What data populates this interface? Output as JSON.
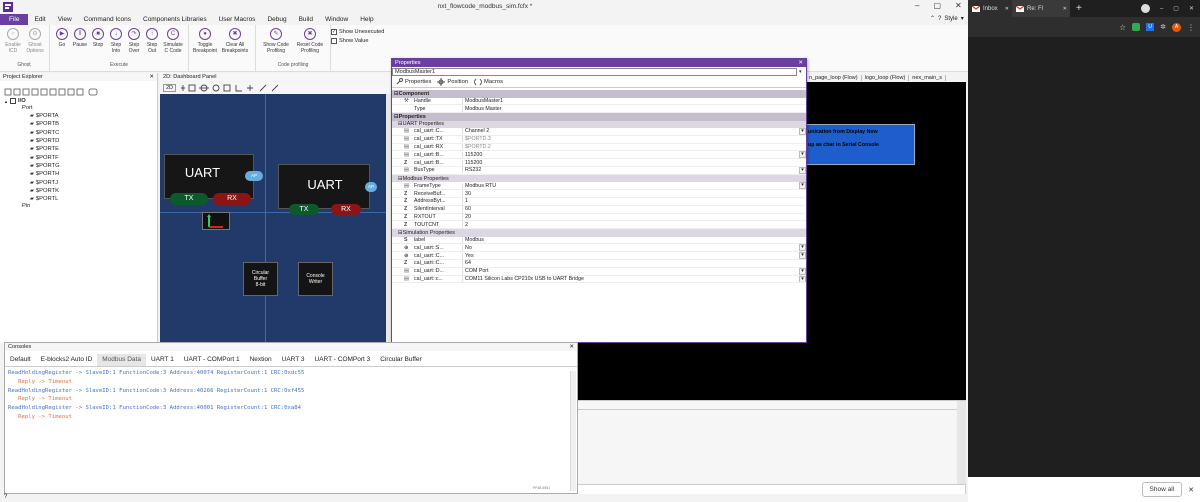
{
  "app": {
    "title": "nxt_flowcode_modbus_sim.fcfx *",
    "style_label": "Style",
    "window_icon": "flowcode-logo-icon"
  },
  "menu": [
    "File",
    "Edit",
    "View",
    "Command Icons",
    "Components Libraries",
    "User Macros",
    "Debug",
    "Build",
    "Window",
    "Help"
  ],
  "ribbon": {
    "groups": [
      {
        "label": "Ghost",
        "buttons": [
          "Enable\nICD",
          "Ghost\nOptions"
        ]
      },
      {
        "label": "Execute",
        "buttons": [
          "Go",
          "Pause",
          "Stop",
          "Step\nInto",
          "Step\nOver",
          "Step\nOut",
          "Simulate\nC Code"
        ]
      },
      {
        "label": "",
        "buttons": [
          "Toggle\nBreakpoint",
          "Clear All\nBreakpoints"
        ]
      },
      {
        "label": "Code profiling",
        "buttons": [
          "Show Code\nProfiling",
          "Reset Code\nProfiling"
        ]
      }
    ],
    "checks": [
      {
        "label": "Show Unexecuted",
        "checked": true
      },
      {
        "label": "Show Value",
        "checked": false
      }
    ]
  },
  "project_explorer": {
    "title": "Project Explorer",
    "root": "I/O",
    "port_label": "Port",
    "ports": [
      "$PORTA",
      "$PORTB",
      "$PORTC",
      "$PORTD",
      "$PORTE",
      "$PORTF",
      "$PORTG",
      "$PORTH",
      "$PORTJ",
      "$PORTK",
      "$PORTL"
    ],
    "pin_label": "Pin"
  },
  "dashboard": {
    "title": "2D: Dashboard Panel",
    "toolbar_label": "2D",
    "uart1": {
      "title": "UART",
      "tx": "TX",
      "rx": "RX",
      "badge": "AP"
    },
    "uart2": {
      "title": "UART",
      "tx": "TX",
      "rx": "RX",
      "badge": "AP"
    },
    "circular_buffer": "Circular\nBuffer\n8-bit",
    "console_writer": "Console\nWriter"
  },
  "properties": {
    "title": "Properties",
    "selector": "ModbusMaster1",
    "tabs": [
      "Properties",
      "Position",
      "Macros"
    ],
    "sections": [
      {
        "type": "section",
        "label": "Component"
      },
      {
        "type": "row",
        "icon": "wrench",
        "key": "Handle",
        "value": "ModbusMaster1",
        "dd": false
      },
      {
        "type": "row",
        "icon": "",
        "key": "Type",
        "value": "Modbus Master",
        "dd": false
      },
      {
        "type": "section",
        "label": "Properties"
      },
      {
        "type": "subsection",
        "label": "UART Properties"
      },
      {
        "type": "row",
        "icon": "list",
        "key": "cal_uart::C...",
        "value": "Channel 2",
        "dd": true
      },
      {
        "type": "row",
        "icon": "list",
        "key": "cal_uart::TX",
        "value": "$PORTD.3",
        "dd": false,
        "muted": true
      },
      {
        "type": "row",
        "icon": "list",
        "key": "cal_uart::RX",
        "value": "$PORTD.2",
        "dd": false,
        "muted": true
      },
      {
        "type": "row",
        "icon": "list",
        "key": "cal_uart::B...",
        "value": "115200",
        "dd": true
      },
      {
        "type": "row",
        "icon": "Z",
        "key": "cal_uart::B...",
        "value": "115200",
        "dd": false
      },
      {
        "type": "row",
        "icon": "list",
        "key": "BusType",
        "value": "RS232",
        "dd": true
      },
      {
        "type": "subsection",
        "label": "Modbus Properties"
      },
      {
        "type": "row",
        "icon": "list",
        "key": "FrameType",
        "value": "Modbus RTU",
        "dd": true
      },
      {
        "type": "row",
        "icon": "Z",
        "key": "ReceiveBuf...",
        "value": "30",
        "dd": false
      },
      {
        "type": "row",
        "icon": "Z",
        "key": "AddressByt...",
        "value": "1",
        "dd": false
      },
      {
        "type": "row",
        "icon": "Z",
        "key": "SilentInterval",
        "value": "60",
        "dd": false
      },
      {
        "type": "row",
        "icon": "Z",
        "key": "RXTOUT",
        "value": "20",
        "dd": false
      },
      {
        "type": "row",
        "icon": "Z",
        "key": "TOUTCNT",
        "value": "2",
        "dd": false
      },
      {
        "type": "subsection",
        "label": "Simulation Properties"
      },
      {
        "type": "row",
        "icon": "S",
        "key": "label",
        "value": "Modbus",
        "dd": false
      },
      {
        "type": "row",
        "icon": "plus",
        "key": "cal_uart::S...",
        "value": "No",
        "dd": true
      },
      {
        "type": "row",
        "icon": "plus",
        "key": "cal_uart::C...",
        "value": "Yes",
        "dd": true
      },
      {
        "type": "row",
        "icon": "Z",
        "key": "cal_uart::C...",
        "value": "64",
        "dd": false
      },
      {
        "type": "row",
        "icon": "list",
        "key": "cal_uart::D...",
        "value": "COM Port",
        "dd": true
      },
      {
        "type": "row",
        "icon": "list",
        "key": "cal_uart::c...",
        "value": "COM11 Silicon Labs CP210x USB to UART Bridge",
        "dd": true
      }
    ]
  },
  "flow_tabs": [
    "n_page_loop (Flow)",
    "logo_loop (Flow)",
    "nex_main_s"
  ],
  "display": {
    "line1": "unication from Display Now",
    "line2": "up as char in Serial Console"
  },
  "consoles": {
    "title": "Consoles",
    "tabs": [
      "Default",
      "E-blocks2 Auto ID",
      "Modbus Data",
      "UART 1",
      "UART - COMPort 1",
      "Nextion",
      "UART 3",
      "UART - COMPort 3",
      "Circular Buffer"
    ],
    "active_tab": "Modbus Data",
    "lines": [
      {
        "text": "ReadHoldingRegister -> SlaveID:1 FunctionCode:3 Address:40074 RegisterCount:1 CRC:0xdc55",
        "color": "#4472c4"
      },
      {
        "text": "   Reply -> Timeout",
        "color": "#e0703c"
      },
      {
        "text": "ReadHoldingRegister -> SlaveID:1 FunctionCode:3 Address:40266 RegisterCount:1 CRC:0xf455",
        "color": "#4472c4"
      },
      {
        "text": "   Reply -> Timeout",
        "color": "#e0703c"
      },
      {
        "text": "ReadHoldingRegister -> SlaveID:1 FunctionCode:3 Address:40001 RegisterCount:1 CRC:0xa84",
        "color": "#4472c4"
      },
      {
        "text": "   Reply -> Timeout",
        "color": "#e0703c"
      }
    ],
    "footer_note": "FF48-4951"
  },
  "browser": {
    "tabs": [
      {
        "label": "Inbox",
        "icon": "gmail-icon"
      },
      {
        "label": "Re: Fl",
        "icon": "gmail-icon"
      }
    ],
    "new_tab_label": "+",
    "show_all": "Show all"
  },
  "colors": {
    "accent_purple": "#6b3fa0",
    "dashboard_bg": "#223a6a",
    "uart_red": "#8b1414",
    "uart_green": "#0c5a2c",
    "panel_blue": "#1d5ecc"
  }
}
